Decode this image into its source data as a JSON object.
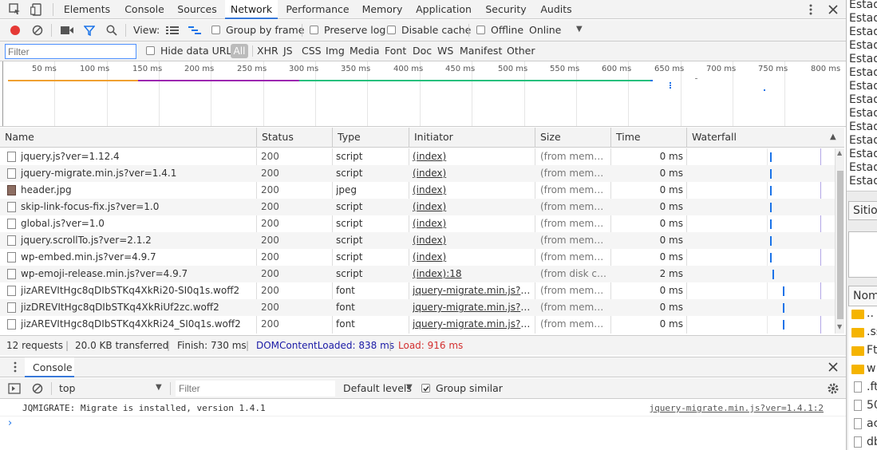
{
  "tabs": [
    "Elements",
    "Console",
    "Sources",
    "Network",
    "Performance",
    "Memory",
    "Application",
    "Security",
    "Audits"
  ],
  "active_tab": "Network",
  "toolbar": {
    "view_label": "View:",
    "group_by_frame": "Group by frame",
    "preserve_log": "Preserve log",
    "disable_cache": "Disable cache",
    "offline": "Offline",
    "throttle": "Online"
  },
  "filter": {
    "placeholder": "Filter",
    "hide_data_urls": "Hide data URLs",
    "types": [
      "All",
      "XHR",
      "JS",
      "CSS",
      "Img",
      "Media",
      "Font",
      "Doc",
      "WS",
      "Manifest",
      "Other"
    ]
  },
  "overview_ticks": [
    "50 ms",
    "100 ms",
    "150 ms",
    "200 ms",
    "250 ms",
    "300 ms",
    "350 ms",
    "400 ms",
    "450 ms",
    "500 ms",
    "550 ms",
    "600 ms",
    "650 ms",
    "700 ms",
    "750 ms",
    "800 ms"
  ],
  "columns": [
    "Name",
    "Status",
    "Type",
    "Initiator",
    "Size",
    "Time",
    "Waterfall"
  ],
  "rows": [
    {
      "name": "jquery.js?ver=1.12.4",
      "status": "200",
      "type": "script",
      "initiator": "(index)",
      "size": "(from memor…",
      "time": "0 ms",
      "wf": 0.56
    },
    {
      "name": "jquery-migrate.min.js?ver=1.4.1",
      "status": "200",
      "type": "script",
      "initiator": "(index)",
      "size": "(from memor…",
      "time": "0 ms",
      "wf": 0.56
    },
    {
      "name": "header.jpg",
      "status": "200",
      "type": "jpeg",
      "initiator": "(index)",
      "size": "(from memor…",
      "time": "0 ms",
      "wf": 0.56
    },
    {
      "name": "skip-link-focus-fix.js?ver=1.0",
      "status": "200",
      "type": "script",
      "initiator": "(index)",
      "size": "(from memor…",
      "time": "0 ms",
      "wf": 0.56
    },
    {
      "name": "global.js?ver=1.0",
      "status": "200",
      "type": "script",
      "initiator": "(index)",
      "size": "(from memor…",
      "time": "0 ms",
      "wf": 0.56
    },
    {
      "name": "jquery.scrollTo.js?ver=2.1.2",
      "status": "200",
      "type": "script",
      "initiator": "(index)",
      "size": "(from memor…",
      "time": "0 ms",
      "wf": 0.56
    },
    {
      "name": "wp-embed.min.js?ver=4.9.7",
      "status": "200",
      "type": "script",
      "initiator": "(index)",
      "size": "(from memor…",
      "time": "0 ms",
      "wf": 0.56
    },
    {
      "name": "wp-emoji-release.min.js?ver=4.9.7",
      "status": "200",
      "type": "script",
      "initiator": "(index):18",
      "size": "(from disk ca…",
      "time": "2 ms",
      "wf": 0.58
    },
    {
      "name": "jizAREVItHgc8qDIbSTKq4XkRi20-SI0q1s.woff2",
      "status": "200",
      "type": "font",
      "initiator": "jquery-migrate.min.js?ve…",
      "size": "(from memor…",
      "time": "0 ms",
      "wf": 0.65
    },
    {
      "name": "jizDREVItHgc8qDIbSTKq4XkRiUf2zc.woff2",
      "status": "200",
      "type": "font",
      "initiator": "jquery-migrate.min.js?ve…",
      "size": "(from memor…",
      "time": "0 ms",
      "wf": 0.65
    },
    {
      "name": "jizAREVItHgc8qDIbSTKq4XkRi24_SI0q1s.woff2",
      "status": "200",
      "type": "font",
      "initiator": "jquery-migrate.min.js?ve…",
      "size": "(from memor…",
      "time": "0 ms",
      "wf": 0.65
    }
  ],
  "status": {
    "requests": "12 requests",
    "transferred": "20.0 KB transferred",
    "finish": "Finish: 730 ms",
    "dcl": "DOMContentLoaded: 838 ms",
    "load": "Load: 916 ms",
    "dcl_color": "#1a1aa6",
    "load_color": "#d32f2f"
  },
  "console": {
    "tab": "Console",
    "context": "top",
    "filter_placeholder": "Filter",
    "levels": "Default levels",
    "group_similar": "Group similar",
    "message": "JQMIGRATE: Migrate is installed, version 1.4.1",
    "source": "jquery-migrate.min.js?ver=1.4.1:2"
  },
  "right_panel": {
    "estad_lines": [
      "Estad",
      "Estad",
      "Estad",
      "Estad",
      "Estad",
      "Estad",
      "Estad",
      "Estad",
      "Estad",
      "Estad",
      "Estad",
      "Estad",
      "Estad",
      "Estad"
    ],
    "sitio": "Sitio",
    "nom": "Nom",
    "files": [
      "..",
      ".ss",
      "Ft",
      "w",
      ".ft",
      "50",
      "ac",
      "db"
    ]
  }
}
